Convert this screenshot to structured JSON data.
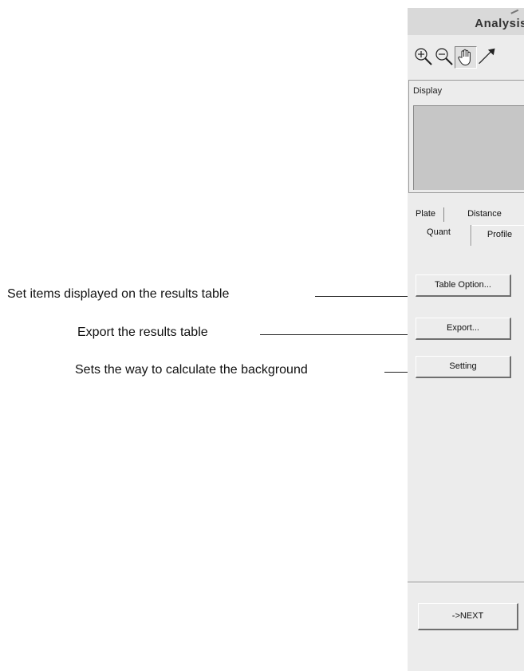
{
  "panel": {
    "title": "Analysis",
    "toolbar": [
      {
        "icon": "zoom-in-icon"
      },
      {
        "icon": "zoom-out-icon"
      },
      {
        "icon": "hand-pan-icon"
      },
      {
        "icon": "pick-arrow-icon"
      }
    ],
    "display_group": {
      "label": "Display"
    },
    "tabs": {
      "row1": [
        "Plate",
        "Distance"
      ],
      "row2": [
        "Quant",
        "Profile"
      ],
      "selected": "Quant"
    },
    "buttons": {
      "table_option": "Table Option...",
      "export": "Export...",
      "setting": "Setting",
      "next": "->NEXT"
    }
  },
  "annotations": {
    "table_option": "Set items displayed on the results table",
    "export": "Export the results table",
    "setting": "Sets the way to calculate the background"
  }
}
